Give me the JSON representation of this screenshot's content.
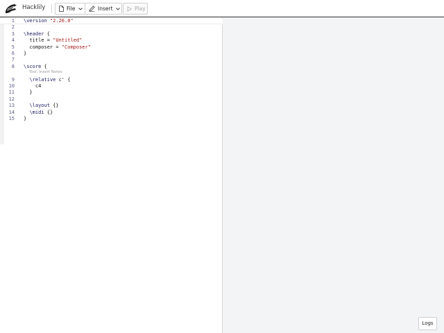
{
  "app": {
    "name": "Hacklily"
  },
  "toolbar": {
    "file_label": "File",
    "insert_label": "Insert",
    "play_label": "Play"
  },
  "editor": {
    "hint": "Tool: Insert Notes",
    "lines": [
      {
        "num": "1",
        "text": "\\version \"2.26.0\""
      },
      {
        "num": "2",
        "text": ""
      },
      {
        "num": "3",
        "text": "\\header {"
      },
      {
        "num": "4",
        "text": "  title = \"Untitled\""
      },
      {
        "num": "5",
        "text": "  composer = \"Composer\""
      },
      {
        "num": "6",
        "text": "}"
      },
      {
        "num": "7",
        "text": ""
      },
      {
        "num": "8",
        "text": "\\score {"
      },
      {
        "num": "9",
        "text": "  \\relative c' {"
      },
      {
        "num": "10",
        "text": "    c4"
      },
      {
        "num": "11",
        "text": "  }"
      },
      {
        "num": "12",
        "text": ""
      },
      {
        "num": "13",
        "text": "  \\layout {}"
      },
      {
        "num": "14",
        "text": "  \\midi {}"
      },
      {
        "num": "15",
        "text": "}"
      }
    ]
  },
  "preview": {
    "logs_label": "Logs"
  },
  "icons": {
    "logo": "lily-logo-icon",
    "file": "file-icon",
    "insert": "pencil-icon",
    "play": "play-icon",
    "chevron": "chevron-down-icon"
  },
  "colors": {
    "string": "#a31515",
    "keyword": "#1a1a5e",
    "preview_bg": "#f3f4f6",
    "line_number": "#5c5c8a"
  }
}
